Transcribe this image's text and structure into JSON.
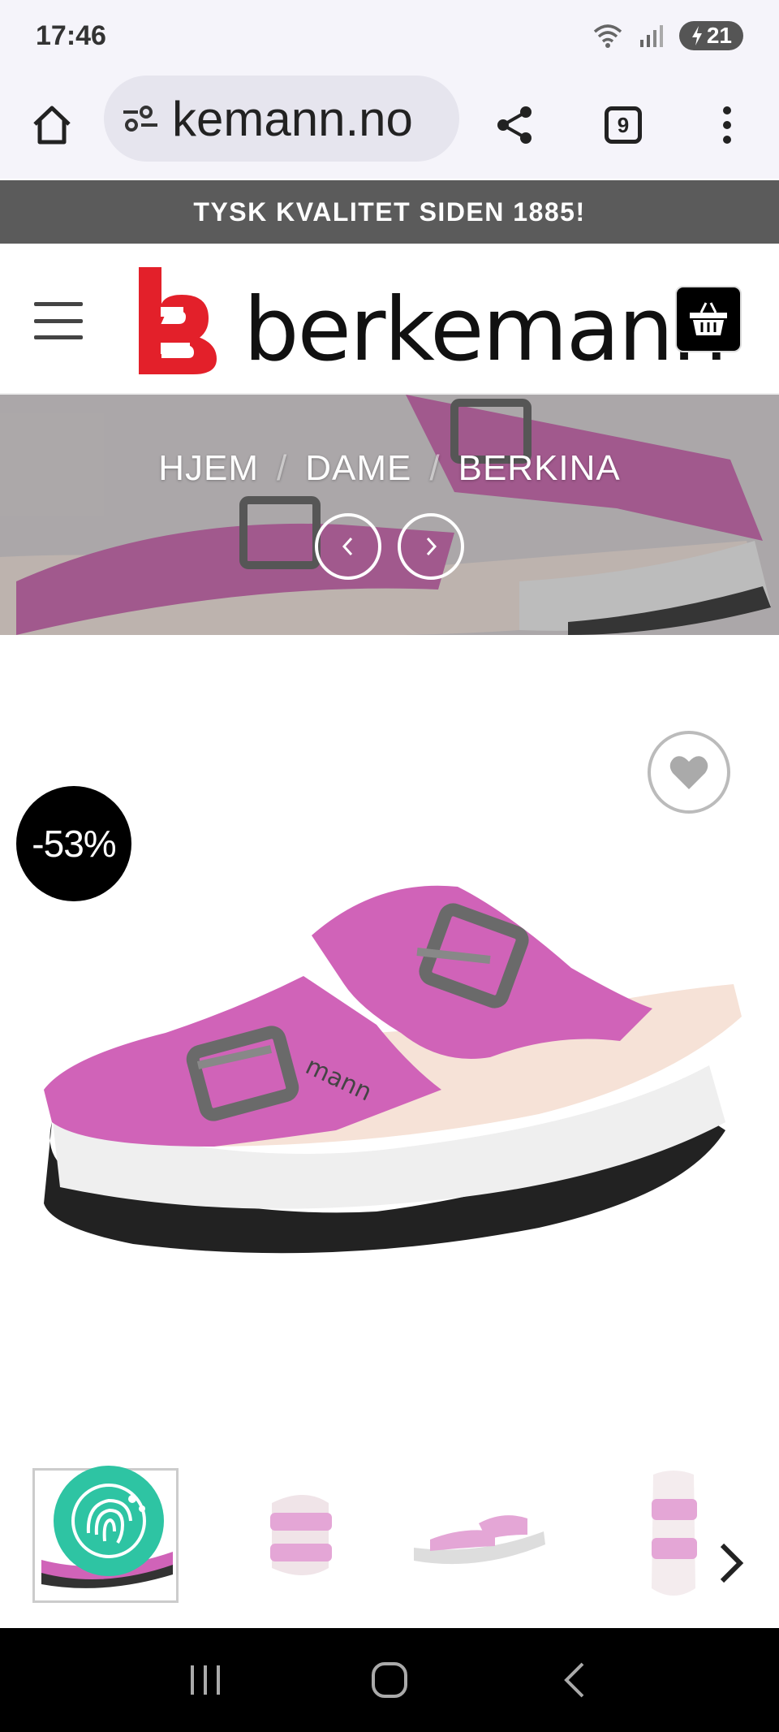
{
  "status_bar": {
    "time": "17:46",
    "battery": "21",
    "icons": [
      "wifi-icon",
      "signal-icon",
      "battery-icon"
    ]
  },
  "browser": {
    "url": "kemann.no",
    "tab_count": "9",
    "icons": [
      "home-icon",
      "site-settings-icon",
      "share-icon",
      "tabs-icon",
      "more-vert-icon"
    ]
  },
  "promo_banner": {
    "text": "TYSK KVALITET SIDEN 1885!"
  },
  "header": {
    "brand": "berkemann",
    "icons": [
      "menu-icon",
      "logo-mark",
      "cart-icon"
    ]
  },
  "breadcrumb": {
    "items": [
      "HJEM",
      "DAME",
      "BERKINA"
    ],
    "separator": "/"
  },
  "product": {
    "discount_badge": "-53%",
    "shoe_color": "#d063b8",
    "icons": [
      "heart-icon",
      "chevron-right-icon",
      "cookie-consent-icon"
    ]
  },
  "colors": {
    "brand_red": "#e3202a",
    "promo_bg": "#5b5b5b",
    "cookie_teal": "#2ec4a3"
  },
  "system_nav": {
    "icons": [
      "recents-icon",
      "home-nav-icon",
      "back-icon"
    ]
  }
}
